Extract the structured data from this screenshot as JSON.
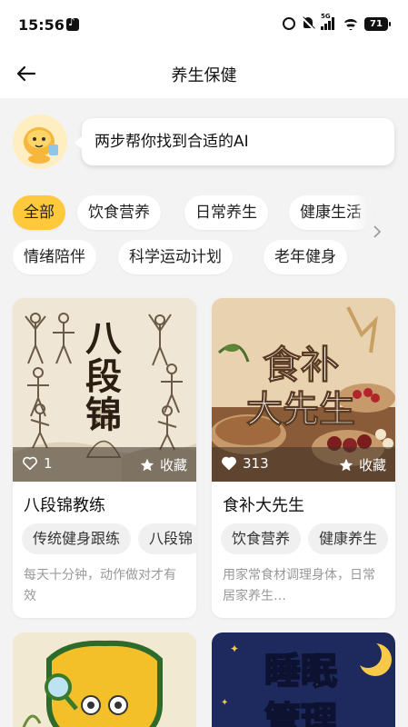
{
  "status_bar": {
    "time": "15:56",
    "network": "5G",
    "battery": "71"
  },
  "header": {
    "title": "养生保健"
  },
  "intro": {
    "text": "两步帮你找到合适的AI"
  },
  "tags": [
    "全部",
    "饮食营养",
    "日常养生",
    "健康生活",
    "情绪陪伴",
    "科学运动计划",
    "老年健身"
  ],
  "cards": [
    {
      "image_text": "八段锦",
      "likes": "1",
      "fav_label": "收藏",
      "title": "八段锦教练",
      "tags": [
        "传统健身跟练",
        "八段锦"
      ],
      "desc": "每天十分钟，动作做对才有效"
    },
    {
      "image_text": [
        "食补",
        "大先生"
      ],
      "likes": "313",
      "fav_label": "收藏",
      "title": "食补大先生",
      "tags": [
        "饮食营养",
        "健康养生"
      ],
      "desc": "用家常食材调理身体，日常居家养生…"
    },
    {
      "image_text": ""
    },
    {
      "image_text": [
        "睡眠",
        "管理"
      ]
    }
  ],
  "colors": {
    "accent": "#ffc93c",
    "background": "#f3f3f3"
  }
}
